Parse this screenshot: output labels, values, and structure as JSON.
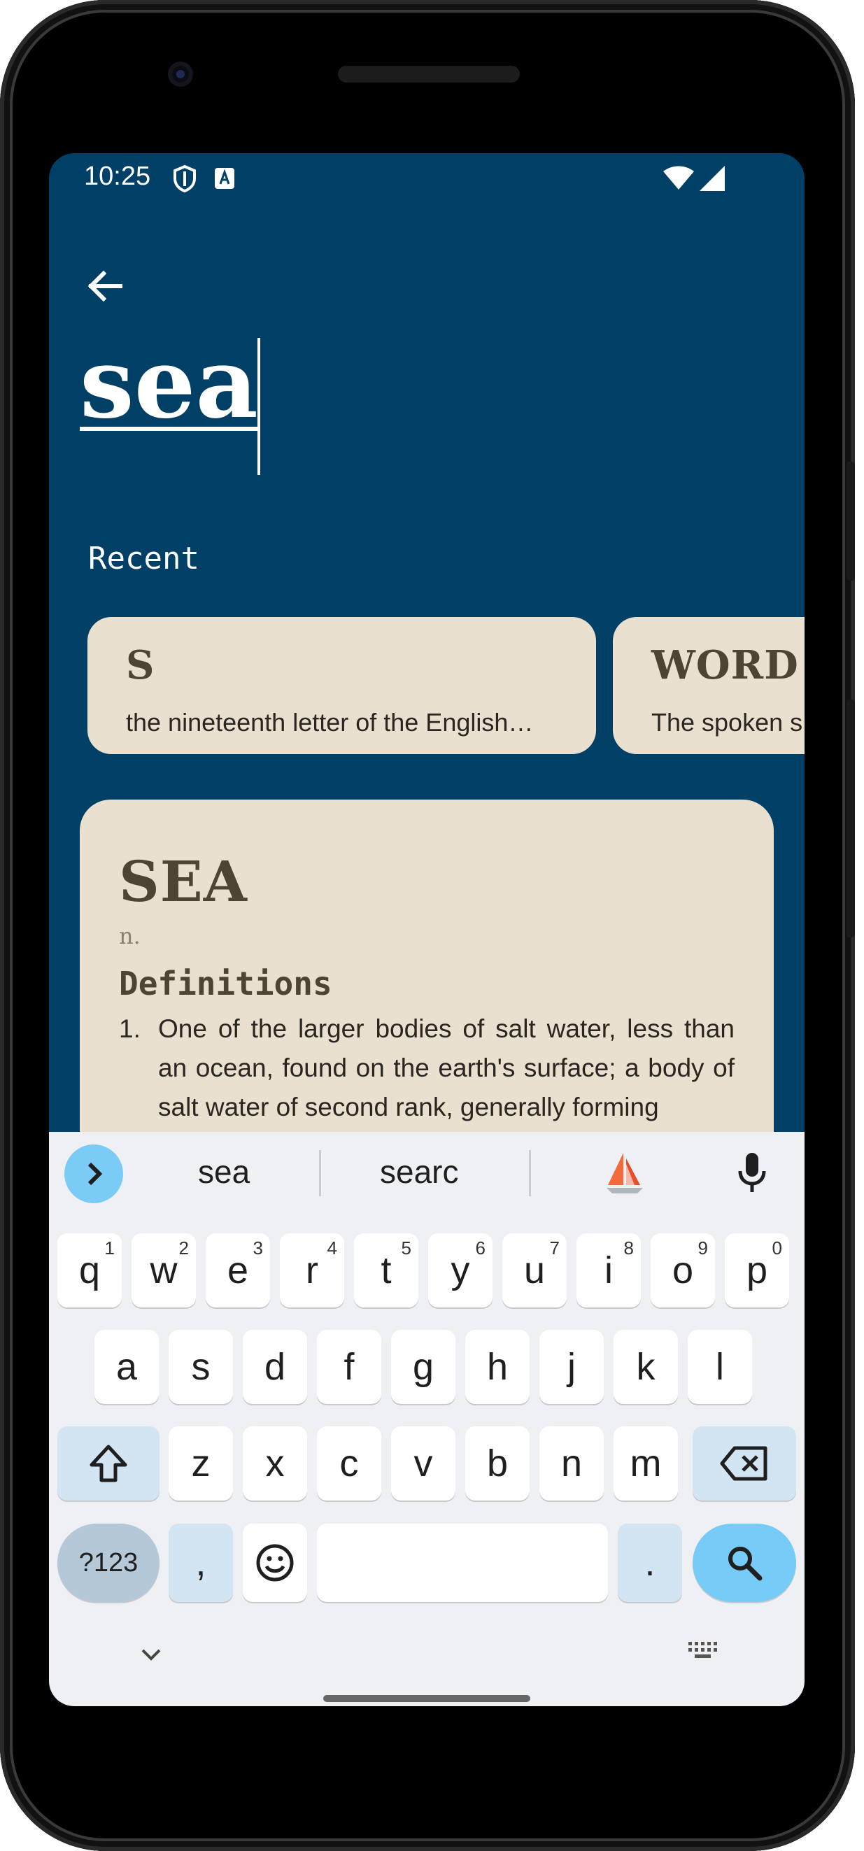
{
  "status_bar": {
    "time": "10:25"
  },
  "search": {
    "query": "sea"
  },
  "recent": {
    "label": "Recent",
    "items": [
      {
        "word": "S",
        "definition": "the nineteenth letter of the English…"
      },
      {
        "word": "WORD",
        "definition": "The spoken s"
      }
    ]
  },
  "entry": {
    "word": "SEA",
    "part_of_speech": "n.",
    "definitions_heading": "Definitions",
    "definitions": [
      {
        "number": "1.",
        "text": "One of the larger bodies of salt water, less than an ocean, found on the earth's surface; a body of salt water of second rank, generally forming"
      }
    ]
  },
  "keyboard": {
    "suggestions": [
      "sea",
      "searc"
    ],
    "row1": [
      {
        "k": "q",
        "s": "1"
      },
      {
        "k": "w",
        "s": "2"
      },
      {
        "k": "e",
        "s": "3"
      },
      {
        "k": "r",
        "s": "4"
      },
      {
        "k": "t",
        "s": "5"
      },
      {
        "k": "y",
        "s": "6"
      },
      {
        "k": "u",
        "s": "7"
      },
      {
        "k": "i",
        "s": "8"
      },
      {
        "k": "o",
        "s": "9"
      },
      {
        "k": "p",
        "s": "0"
      }
    ],
    "row2": [
      "a",
      "s",
      "d",
      "f",
      "g",
      "h",
      "j",
      "k",
      "l"
    ],
    "row3": [
      "z",
      "x",
      "c",
      "v",
      "b",
      "n",
      "m"
    ],
    "symbols_label": "?123",
    "comma": ",",
    "period": "."
  },
  "colors": {
    "background": "#003F66",
    "card": "#EAE0CF",
    "card_title": "#4E4436",
    "keyboard_accent": "#76CCF7"
  }
}
